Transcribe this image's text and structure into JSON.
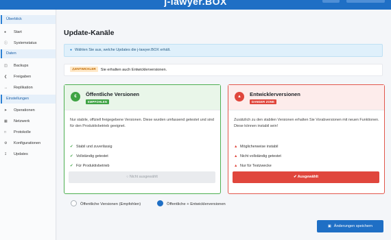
{
  "header": {
    "app_title": "j-lawyer.BOX"
  },
  "sidebar": {
    "sections": [
      {
        "label": "Überblick",
        "items": [
          {
            "label": "Start",
            "icon": "home-icon"
          },
          {
            "label": "Systemstatus",
            "icon": "info-icon"
          }
        ]
      },
      {
        "label": "Daten",
        "items": [
          {
            "label": "Backups",
            "icon": "database-icon"
          },
          {
            "label": "Freigaben",
            "icon": "share-icon"
          },
          {
            "label": "Replikation",
            "icon": "sync-icon"
          }
        ]
      },
      {
        "label": "Einstellungen",
        "items": [
          {
            "label": "Operationen",
            "icon": "rocket-icon"
          },
          {
            "label": "Netzwerk",
            "icon": "network-icon"
          },
          {
            "label": "Protokolle",
            "icon": "file-icon"
          },
          {
            "label": "Konfigurationen",
            "icon": "gears-icon"
          },
          {
            "label": "Updates",
            "icon": "download-icon"
          }
        ]
      }
    ]
  },
  "main": {
    "title": "Update-Kanäle",
    "info_text": "Wählen Sie aus, welche Updates die j-lawyer.BOX erhält.",
    "dev_badge": "ENTWICKLER",
    "dev_notice": "Sie erhalten auch Entwicklerversionen.",
    "public_card": {
      "title": "Öffentliche Versionen",
      "badge": "EMPFOHLEN",
      "description": "Nur stabile, offiziell freigegebene Versionen. Diese wurden umfassend getestet und sind für den Produktivbetrieb geeignet.",
      "features": [
        "Stabil und zuverlässig",
        "Vollständig getestet",
        "Für Produktivbetrieb"
      ],
      "button": "Nicht ausgewählt"
    },
    "dev_card": {
      "title": "Entwicklerversionen",
      "badge": "DANGER ZONE",
      "description": "Zusätzlich zu den stabilen Versionen erhalten Sie Vorabversionen mit neuen Funktionen. Diese können instabil sein!",
      "features": [
        "Möglicherweise instabil",
        "Nicht vollständig getestet",
        "Nur für Testzwecke"
      ],
      "button": "Ausgewählt"
    },
    "radio_options": [
      {
        "label": "Öffentliche Versionen (Empfohlen)",
        "selected": false
      },
      {
        "label": "Öffentliche + Entwicklerversionen",
        "selected": true
      }
    ],
    "save_label": "Änderungen speichern"
  },
  "colors": {
    "accent": "#1f6fc5",
    "success": "#3fa344",
    "danger": "#e0463c"
  }
}
